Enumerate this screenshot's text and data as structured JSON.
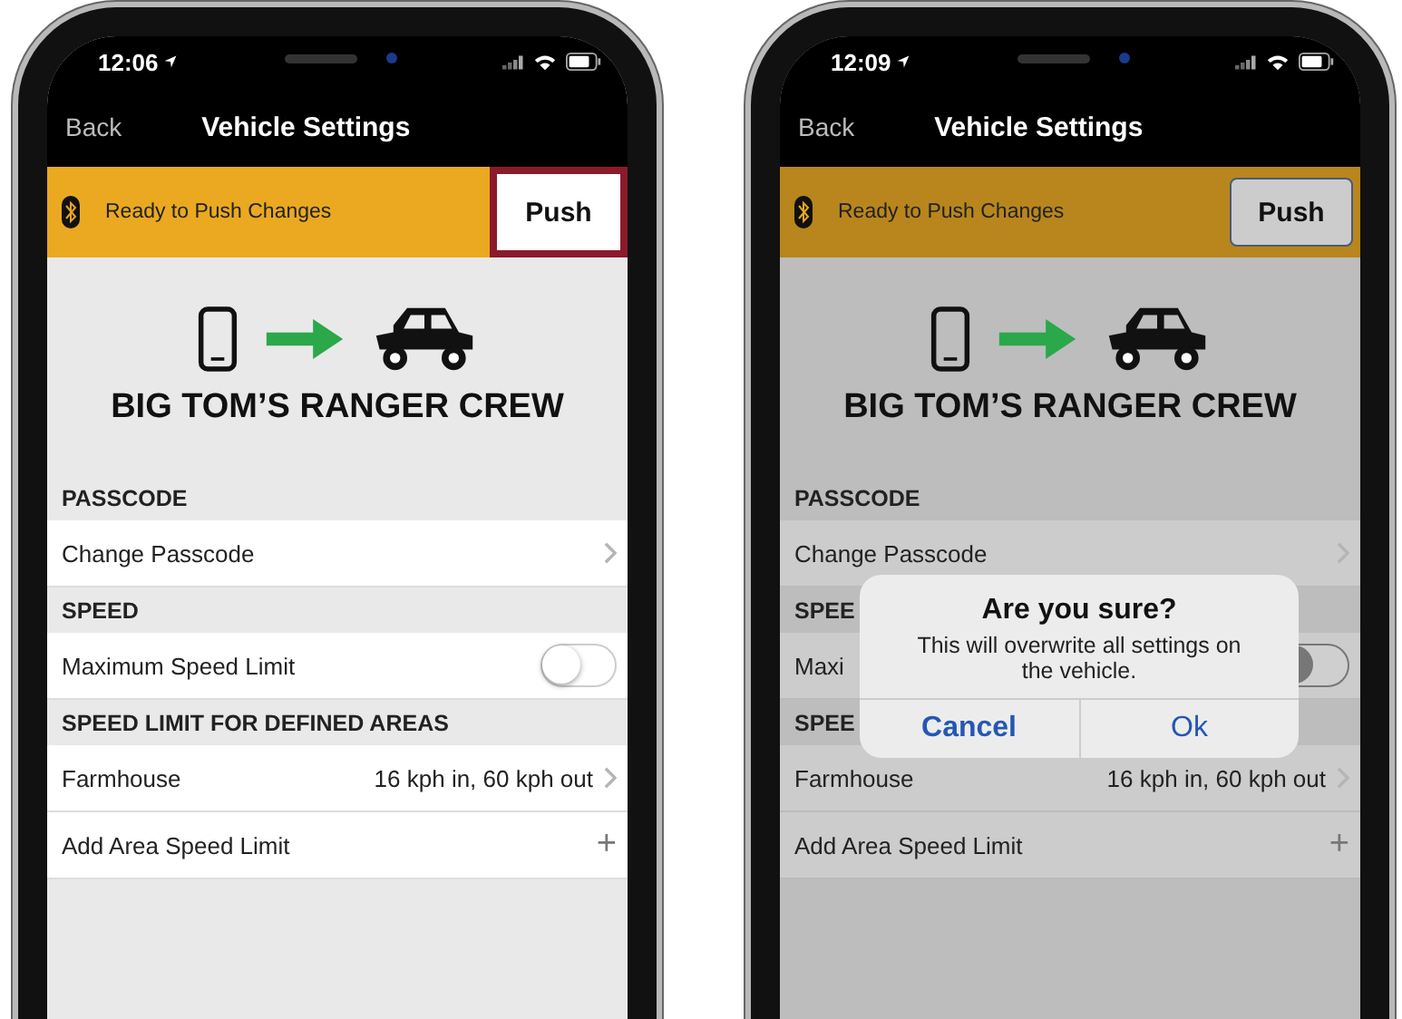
{
  "phones": [
    {
      "time": "12:06",
      "nav": {
        "back": "Back",
        "title": "Vehicle Settings"
      },
      "banner": {
        "text": "Ready to Push Changes",
        "button": "Push",
        "highlighted": true
      },
      "vehicle_name": "BIG TOM’S RANGER CREW",
      "sections": [
        {
          "title": "PASSCODE",
          "rows": [
            {
              "kind": "link",
              "label": "Change Passcode"
            }
          ]
        },
        {
          "title": "SPEED",
          "rows": [
            {
              "kind": "toggle",
              "label": "Maximum Speed Limit",
              "on": false
            }
          ]
        },
        {
          "title": "SPEED LIMIT FOR DEFINED AREAS",
          "rows": [
            {
              "kind": "link",
              "label": "Farmhouse",
              "value": "16 kph in, 60 kph out"
            },
            {
              "kind": "add",
              "label": "Add Area Speed Limit",
              "symbol": "+"
            }
          ]
        }
      ]
    },
    {
      "time": "12:09",
      "nav": {
        "back": "Back",
        "title": "Vehicle Settings"
      },
      "banner": {
        "text": "Ready to Push Changes",
        "button": "Push",
        "highlighted": false
      },
      "vehicle_name": "BIG TOM’S RANGER CREW",
      "sections": [
        {
          "title": "PASSCODE",
          "rows": [
            {
              "kind": "link",
              "label": "Change Passcode"
            }
          ]
        },
        {
          "title": "SPEE",
          "rows": [
            {
              "kind": "toggle",
              "label": "Maxi",
              "on": false
            }
          ]
        },
        {
          "title": "SPEE",
          "rows": [
            {
              "kind": "link",
              "label": "Farmhouse",
              "value": "16 kph in, 60 kph out"
            },
            {
              "kind": "add",
              "label": "Add Area Speed Limit",
              "symbol": "+"
            }
          ]
        }
      ],
      "dialog": {
        "title": "Are you sure?",
        "message": "This will overwrite all settings on the vehicle.",
        "buttons": [
          {
            "label": "Cancel",
            "preferred": true
          },
          {
            "label": "Ok",
            "preferred": false
          }
        ]
      }
    }
  ]
}
